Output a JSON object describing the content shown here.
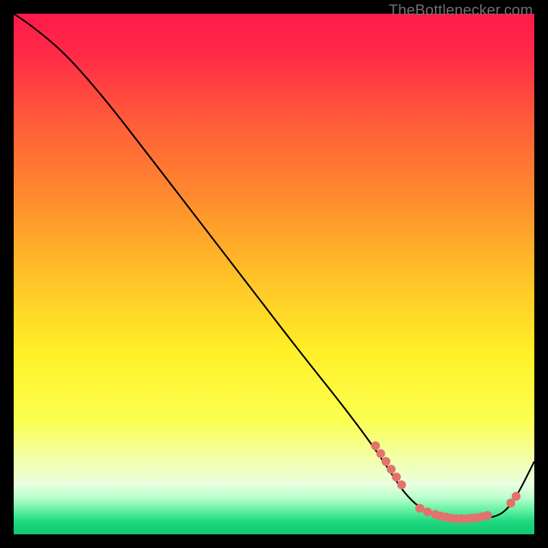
{
  "watermark": "TheBottlenecker.com",
  "chart_data": {
    "type": "line",
    "title": "",
    "xlabel": "",
    "ylabel": "",
    "xlim": [
      0,
      100
    ],
    "ylim": [
      0,
      100
    ],
    "background_gradient": {
      "stops": [
        {
          "offset": 0.0,
          "color": "#ff1a4b"
        },
        {
          "offset": 0.08,
          "color": "#ff2a47"
        },
        {
          "offset": 0.2,
          "color": "#ff5a3a"
        },
        {
          "offset": 0.35,
          "color": "#ff8a2e"
        },
        {
          "offset": 0.5,
          "color": "#ffc028"
        },
        {
          "offset": 0.65,
          "color": "#fff028"
        },
        {
          "offset": 0.78,
          "color": "#fcff50"
        },
        {
          "offset": 0.86,
          "color": "#f2ffb0"
        },
        {
          "offset": 0.905,
          "color": "#e9ffe0"
        },
        {
          "offset": 0.93,
          "color": "#b8ffcc"
        },
        {
          "offset": 0.955,
          "color": "#60f0a0"
        },
        {
          "offset": 0.975,
          "color": "#20d880"
        },
        {
          "offset": 1.0,
          "color": "#10c870"
        }
      ]
    },
    "series": [
      {
        "name": "bottleneck-curve",
        "color": "#000000",
        "x": [
          0,
          3,
          8,
          12,
          18,
          25,
          35,
          45,
          55,
          63,
          69,
          73,
          75,
          78,
          82,
          86,
          90,
          93,
          95,
          97,
          100
        ],
        "y": [
          100,
          98,
          94,
          90,
          83,
          74,
          61,
          48,
          35,
          25,
          17,
          11,
          8,
          5,
          3.5,
          3,
          3,
          3.5,
          5,
          8,
          14
        ]
      }
    ],
    "marker_clusters": [
      {
        "name": "left-descent-cluster",
        "color": "#e2736c",
        "points": [
          {
            "x": 69.5,
            "y": 17
          },
          {
            "x": 70.5,
            "y": 15.5
          },
          {
            "x": 71.5,
            "y": 14
          },
          {
            "x": 72.5,
            "y": 12.5
          },
          {
            "x": 73.5,
            "y": 11
          },
          {
            "x": 74.5,
            "y": 9.5
          }
        ]
      },
      {
        "name": "valley-cluster",
        "color": "#e2736c",
        "points": [
          {
            "x": 78,
            "y": 5
          },
          {
            "x": 79.5,
            "y": 4.3
          },
          {
            "x": 81,
            "y": 3.8
          },
          {
            "x": 82,
            "y": 3.5
          },
          {
            "x": 83,
            "y": 3.3
          },
          {
            "x": 84,
            "y": 3.1
          },
          {
            "x": 85,
            "y": 3
          },
          {
            "x": 86,
            "y": 3
          },
          {
            "x": 87,
            "y": 3
          },
          {
            "x": 88,
            "y": 3.1
          },
          {
            "x": 89,
            "y": 3.2
          },
          {
            "x": 90,
            "y": 3.4
          },
          {
            "x": 91,
            "y": 3.6
          }
        ]
      },
      {
        "name": "right-ascent-cluster",
        "color": "#e2736c",
        "points": [
          {
            "x": 95.5,
            "y": 6
          },
          {
            "x": 96.5,
            "y": 7.3
          }
        ]
      }
    ]
  }
}
